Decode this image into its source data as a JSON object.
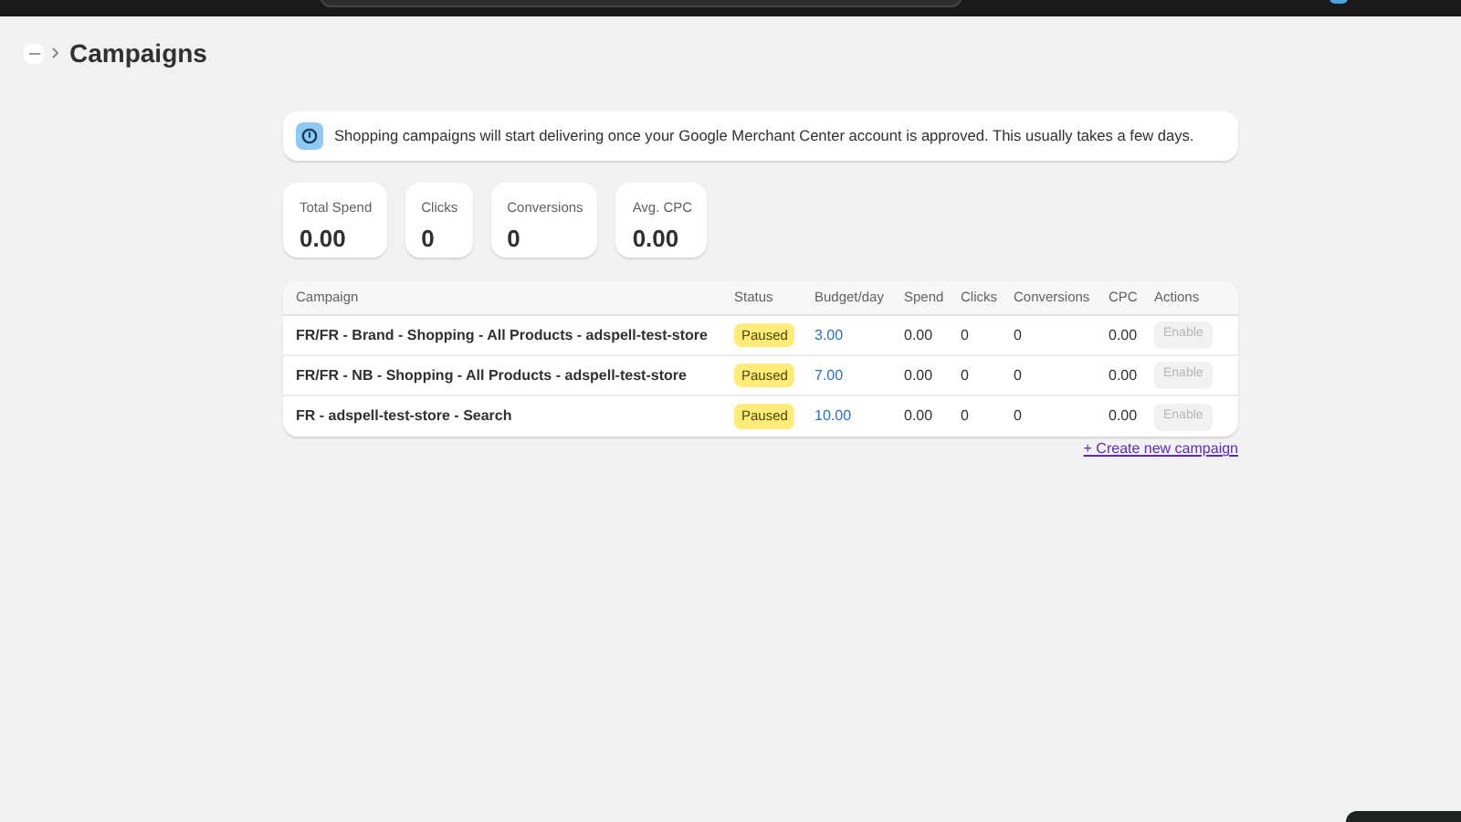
{
  "breadcrumb": {
    "title": "Campaigns"
  },
  "banner": {
    "text": "Shopping campaigns will start delivering once your Google Merchant Center account is approved. This usually takes a few days."
  },
  "stats": [
    {
      "label": "Total Spend",
      "value": "0.00"
    },
    {
      "label": "Clicks",
      "value": "0"
    },
    {
      "label": "Conversions",
      "value": "0"
    },
    {
      "label": "Avg. CPC",
      "value": "0.00"
    }
  ],
  "table": {
    "columns": [
      "Campaign",
      "Status",
      "Budget/day",
      "Spend",
      "Clicks",
      "Conversions",
      "CPC",
      "Actions"
    ],
    "rows": [
      {
        "campaign": "FR/FR - Brand - Shopping - All Products - adspell-test-store",
        "status": "Paused",
        "budget": "3.00",
        "spend": "0.00",
        "clicks": "0",
        "conversions": "0",
        "cpc": "0.00",
        "action": {
          "label": "Enable",
          "disabled": true
        }
      },
      {
        "campaign": "FR/FR - NB - Shopping - All Products - adspell-test-store",
        "status": "Paused",
        "budget": "7.00",
        "spend": "0.00",
        "clicks": "0",
        "conversions": "0",
        "cpc": "0.00",
        "action": {
          "label": "Enable",
          "disabled": true
        }
      },
      {
        "campaign": "FR - adspell-test-store - Search",
        "status": "Paused",
        "budget": "10.00",
        "spend": "0.00",
        "clicks": "0",
        "conversions": "0",
        "cpc": "0.00",
        "action": {
          "label": "Enable",
          "disabled": true
        }
      }
    ]
  },
  "create_link": "+ Create new campaign"
}
